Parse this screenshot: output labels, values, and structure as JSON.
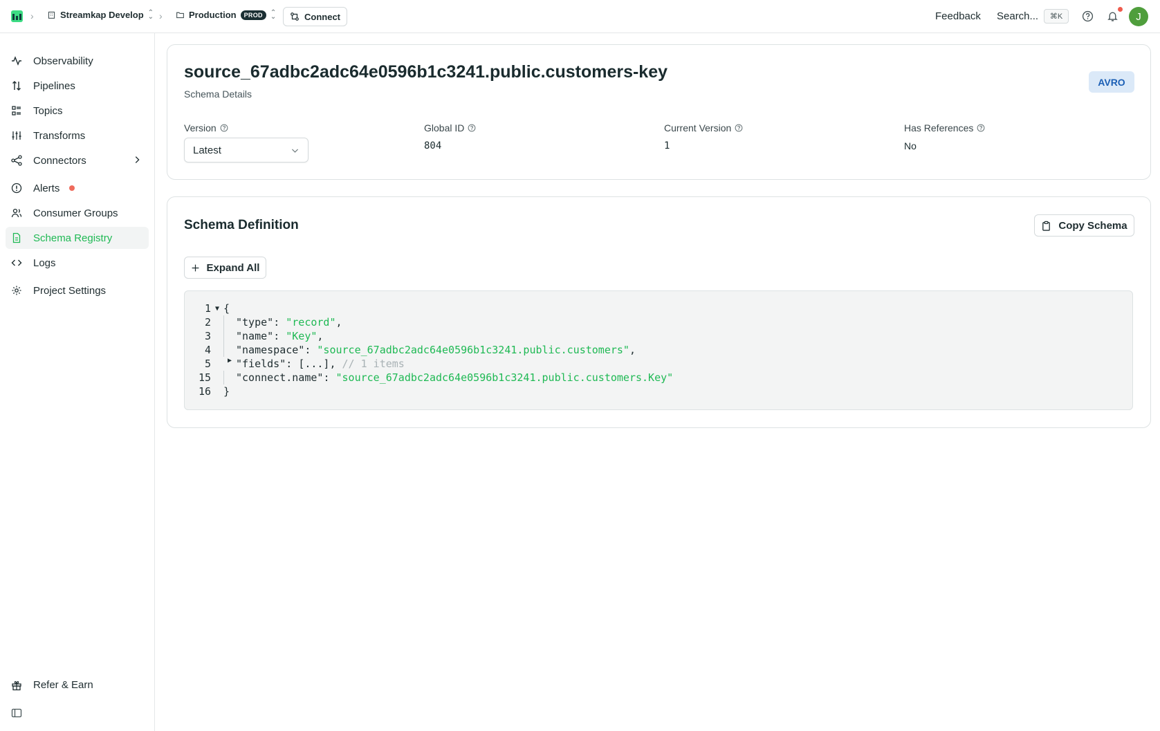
{
  "topbar": {
    "org": "Streamkap Develop",
    "env": "Production",
    "env_badge": "PROD",
    "connect_label": "Connect",
    "feedback_label": "Feedback",
    "search_label": "Search...",
    "search_shortcut": "⌘K",
    "avatar_initial": "J"
  },
  "sidebar": {
    "items": [
      {
        "label": "Observability",
        "icon": "activity-icon"
      },
      {
        "label": "Pipelines",
        "icon": "arrows-up-down-icon"
      },
      {
        "label": "Topics",
        "icon": "list-icon"
      },
      {
        "label": "Transforms",
        "icon": "sliders-icon"
      },
      {
        "label": "Connectors",
        "icon": "share-nodes-icon"
      },
      {
        "label": "Alerts",
        "icon": "alert-circle-icon"
      },
      {
        "label": "Consumer Groups",
        "icon": "users-icon"
      },
      {
        "label": "Schema Registry",
        "icon": "file-icon",
        "active": true
      },
      {
        "label": "Logs",
        "icon": "code-icon"
      },
      {
        "label": "Project Settings",
        "icon": "gear-icon"
      }
    ],
    "refer_label": "Refer & Earn"
  },
  "schema": {
    "title": "source_67adbc2adc64e0596b1c3241.public.customers-key",
    "subtitle": "Schema Details",
    "format_badge": "AVRO",
    "version_label": "Version",
    "version_value": "Latest",
    "global_id_label": "Global ID",
    "global_id_value": "804",
    "current_version_label": "Current Version",
    "current_version_value": "1",
    "has_refs_label": "Has References",
    "has_refs_value": "No"
  },
  "definition": {
    "title": "Schema Definition",
    "copy_label": "Copy Schema",
    "expand_label": "Expand All",
    "lines": [
      {
        "n": "1",
        "text": "{"
      },
      {
        "n": "2",
        "key": "\"type\"",
        "val": "\"record\"",
        "tail": ","
      },
      {
        "n": "3",
        "key": "\"name\"",
        "val": "\"Key\"",
        "tail": ","
      },
      {
        "n": "4",
        "key": "\"namespace\"",
        "val": "\"source_67adbc2adc64e0596b1c3241.public.customers\"",
        "tail": ","
      },
      {
        "n": "5",
        "key": "\"fields\"",
        "plain": "[...],",
        "comment": "// 1 items"
      },
      {
        "n": "15",
        "key": "\"connect.name\"",
        "val": "\"source_67adbc2adc64e0596b1c3241.public.customers.Key\"",
        "tail": ""
      },
      {
        "n": "16",
        "text": "}"
      }
    ]
  },
  "colors": {
    "accent": "#1fb954",
    "badge_bg": "#dbe9f8",
    "badge_text": "#1b5fb5",
    "alert_dot": "#ef6b5c"
  }
}
